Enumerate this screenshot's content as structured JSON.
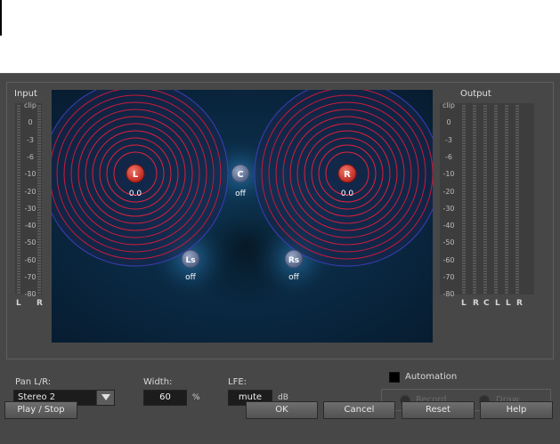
{
  "input": {
    "label": "Input",
    "scale": [
      "clip",
      "0",
      "-3",
      "-6",
      "-10",
      "-20",
      "-30",
      "-40",
      "-50",
      "-60",
      "-70",
      "-80"
    ],
    "channels": [
      "L",
      "R"
    ]
  },
  "output": {
    "label": "Output",
    "scale": [
      "clip",
      "0",
      "-3",
      "-6",
      "-10",
      "-20",
      "-30",
      "-40",
      "-50",
      "-60",
      "-70",
      "-80"
    ],
    "channels": [
      "L",
      "R",
      "C",
      "L",
      "L",
      "R"
    ]
  },
  "speakers": {
    "L": {
      "label": "L",
      "value": "0.0",
      "active": true
    },
    "C": {
      "label": "C",
      "value": "off",
      "active": false
    },
    "R": {
      "label": "R",
      "value": "0.0",
      "active": true
    },
    "Ls": {
      "label": "Ls",
      "value": "off",
      "active": false
    },
    "Rs": {
      "label": "Rs",
      "value": "off",
      "active": false
    }
  },
  "controls": {
    "pan_label": "Pan L/R:",
    "pan_value": "Stereo 2",
    "width_label": "Width:",
    "width_value": "60",
    "width_unit": "%",
    "lfe_label": "LFE:",
    "lfe_value": "mute",
    "lfe_unit": "dB"
  },
  "automation": {
    "label": "Automation",
    "checked": false,
    "record_label": "Record",
    "draw_label": "Draw"
  },
  "buttons": {
    "play_stop": "Play / Stop",
    "ok": "OK",
    "cancel": "Cancel",
    "reset": "Reset",
    "help": "Help"
  },
  "colors": {
    "active_speaker": "#d9453b",
    "inactive_speaker": "#6b7fa3",
    "ring": "#e0203a",
    "field_bg": "#0a2a44"
  }
}
